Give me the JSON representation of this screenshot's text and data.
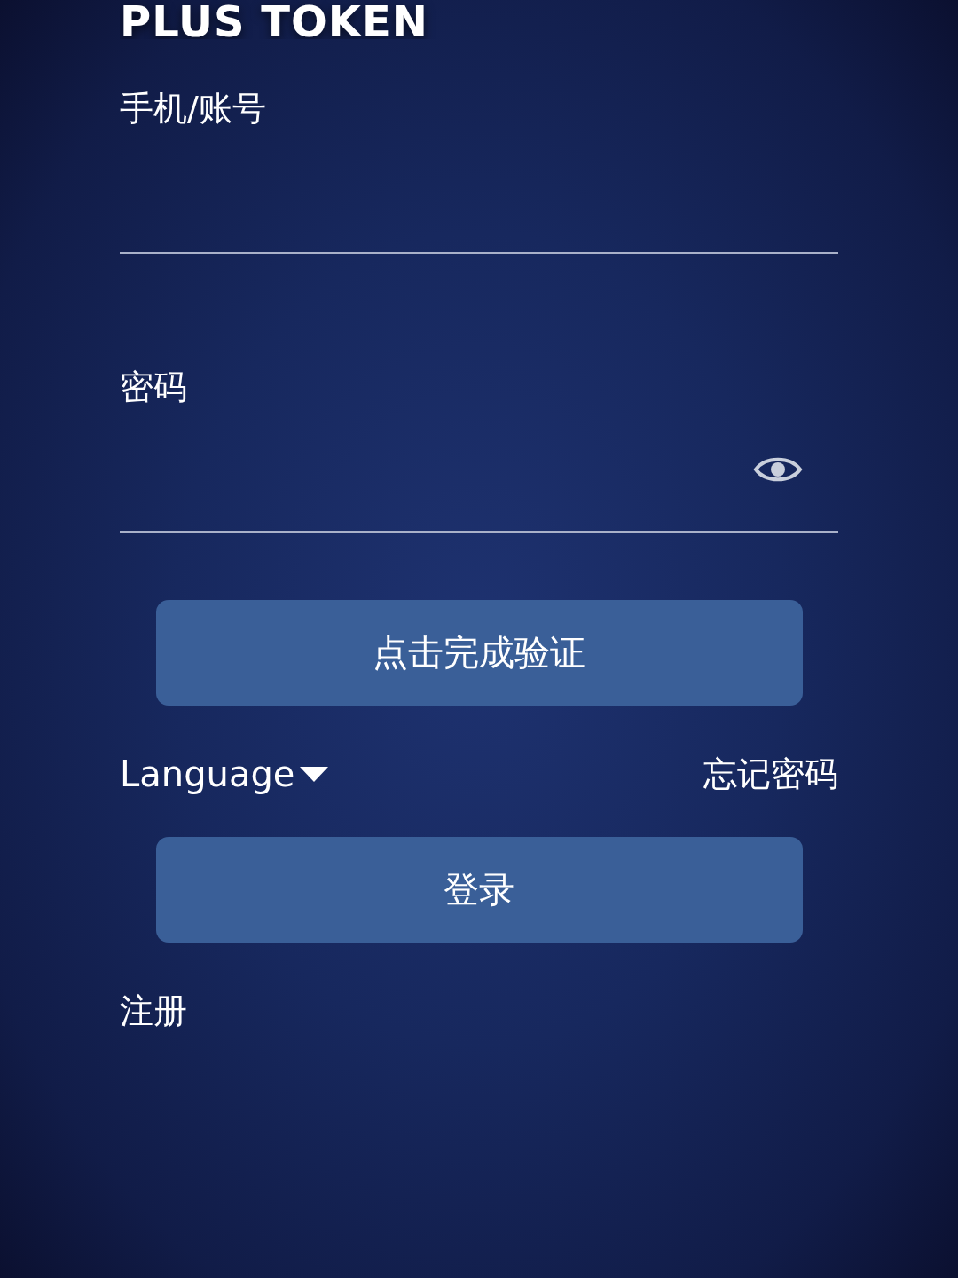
{
  "logo": {
    "text": "PLUS TOKEN"
  },
  "fields": [
    {
      "label": "手机/账号",
      "kind": "text"
    },
    {
      "label": "密码",
      "kind": "password"
    }
  ],
  "verify_button": {
    "label": "点击完成验证"
  },
  "language_selector": {
    "label": "Language"
  },
  "forgot_password": {
    "label": "忘记密码"
  },
  "login_button": {
    "label": "登录"
  },
  "register_link": {
    "label": "注册"
  }
}
